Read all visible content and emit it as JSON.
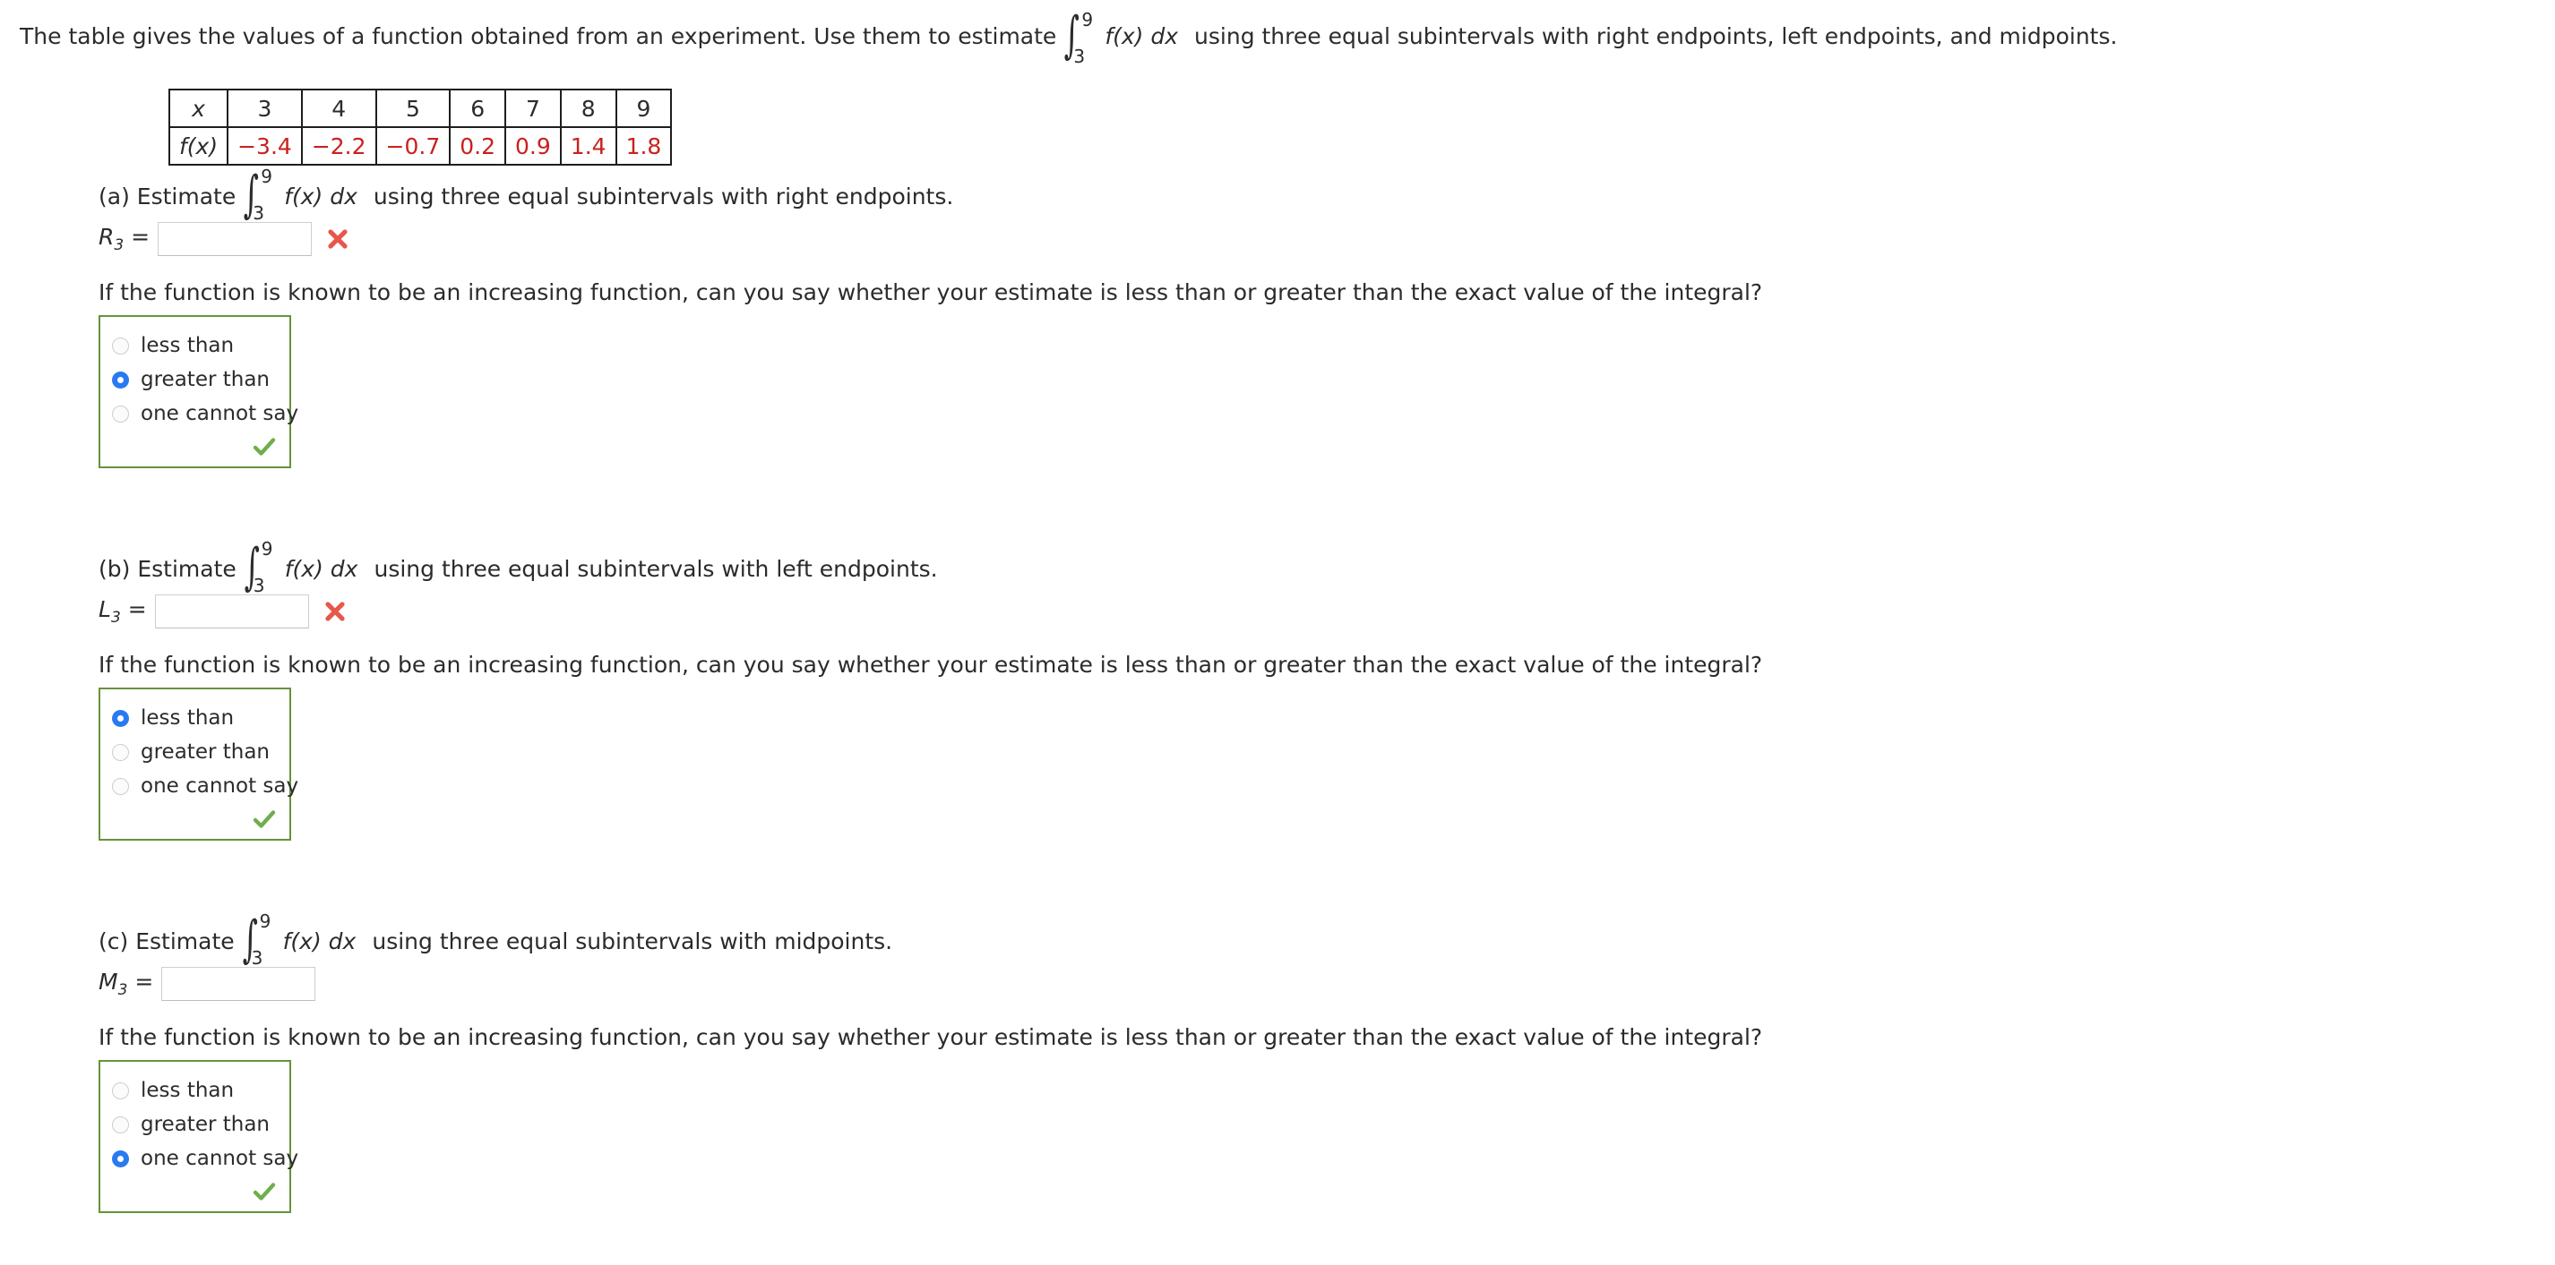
{
  "header": {
    "intro": "The table gives the values of a function obtained from an experiment. Use them to estimate",
    "integral": {
      "lower": "3",
      "upper": "9",
      "integrand": "f(x) dx"
    },
    "tail": "using three equal subintervals with right endpoints, left endpoints, and midpoints."
  },
  "table": {
    "row_labels": [
      "x",
      "f(x)"
    ],
    "x_values": [
      "3",
      "4",
      "5",
      "6",
      "7",
      "8",
      "9"
    ],
    "fx_values": [
      "−3.4",
      "−2.2",
      "−0.7",
      "0.2",
      "0.9",
      "1.4",
      "1.8"
    ],
    "value_color": "#c9211e"
  },
  "subquestion_text": "If the function is known to be an increasing function, can you say whether your estimate is less than or greater than the exact value of the integral?",
  "icons": {
    "incorrect": "x-mark-icon",
    "correct": "check-mark-icon",
    "incorrect_color": "#e8574c",
    "correct_color": "#6fae4d",
    "radio_selected_color": "#2979f2",
    "choice_box_border_color": "#66933a"
  },
  "parts": [
    {
      "label": "(a) Estimate",
      "integral": {
        "lower": "3",
        "upper": "9",
        "integrand": "f(x) dx"
      },
      "tail": "using three equal subintervals with right endpoints.",
      "variable": "R",
      "subscript": "3",
      "equals": "=",
      "answer_value": "",
      "answer_placeholder": "",
      "status": "incorrect",
      "choices": [
        "less than",
        "greater than",
        "one cannot say"
      ],
      "selected": "greater than",
      "choice_status": "correct"
    },
    {
      "label": "(b) Estimate",
      "integral": {
        "lower": "3",
        "upper": "9",
        "integrand": "f(x) dx"
      },
      "tail": "using three equal subintervals with left endpoints.",
      "variable": "L",
      "subscript": "3",
      "equals": "=",
      "answer_value": "",
      "answer_placeholder": "",
      "status": "incorrect",
      "choices": [
        "less than",
        "greater than",
        "one cannot say"
      ],
      "selected": "less than",
      "choice_status": "correct"
    },
    {
      "label": "(c) Estimate",
      "integral": {
        "lower": "3",
        "upper": "9",
        "integrand": "f(x) dx"
      },
      "tail": "using three equal subintervals with midpoints.",
      "variable": "M",
      "subscript": "3",
      "equals": "=",
      "answer_value": "",
      "answer_placeholder": "",
      "status": "none",
      "choices": [
        "less than",
        "greater than",
        "one cannot say"
      ],
      "selected": "one cannot say",
      "choice_status": "correct"
    }
  ]
}
